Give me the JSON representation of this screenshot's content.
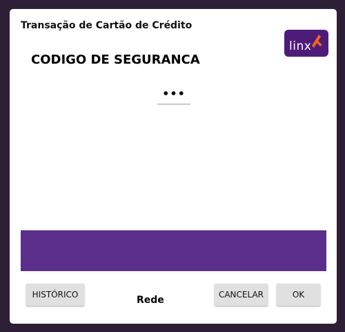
{
  "window": {
    "title": "Transação de Cartão de Crédito"
  },
  "brand": {
    "logo_text": "linx",
    "logo_color": "#4e1c78",
    "accent_color": "#f26522"
  },
  "form": {
    "field_label": "CODIGO DE SEGURANCA",
    "masked_value": "•••"
  },
  "banner": {
    "color": "#5b2e8c"
  },
  "footer": {
    "history_label": "HISTÓRICO",
    "acquirer_label": "Rede",
    "cancel_label": "CANCELAR",
    "ok_label": "OK"
  }
}
